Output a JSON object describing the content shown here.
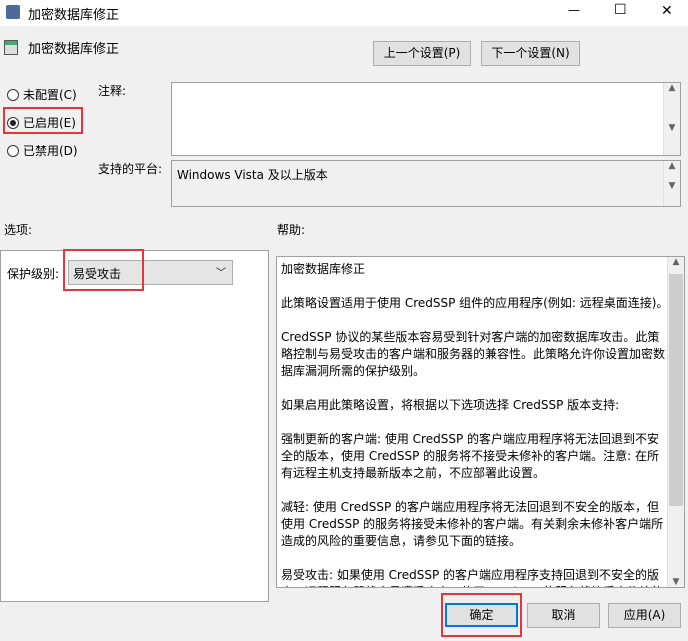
{
  "window": {
    "title": "加密数据库修正",
    "minimize": "—",
    "maximize": "☐",
    "close": "✕"
  },
  "header": {
    "title": "加密数据库修正",
    "prev_button": "上一个设置(P)",
    "next_button": "下一个设置(N)"
  },
  "state": {
    "options": [
      {
        "label": "未配置(C)",
        "selected": false
      },
      {
        "label": "已启用(E)",
        "selected": true
      },
      {
        "label": "已禁用(D)",
        "selected": false
      }
    ]
  },
  "comment": {
    "label": "注释:",
    "value": ""
  },
  "platform": {
    "label": "支持的平台:",
    "value": "Windows Vista 及以上版本"
  },
  "options_section": {
    "label": "选项:",
    "protection_label": "保护级别:",
    "protection_value": "易受攻击"
  },
  "help_section": {
    "label": "帮助:",
    "lines": [
      "加密数据库修正",
      "",
      "此策略设置适用于使用 CredSSP 组件的应用程序(例如: 远程桌面连接)。",
      "",
      "CredSSP 协议的某些版本容易受到针对客户端的加密数据库攻击。此策",
      "略控制与易受攻击的客户端和服务器的兼容性。此策略允许你设置加密数",
      "据库漏洞所需的保护级别。",
      "",
      "如果启用此策略设置，将根据以下选项选择 CredSSP 版本支持:",
      "",
      "强制更新的客户端: 使用 CredSSP 的客户端应用程序将无法回退到不安",
      "全的版本，使用 CredSSP 的服务将不接受未修补的客户端。注意: 在所",
      "有远程主机支持最新版本之前，不应部署此设置。",
      "",
      "减轻: 使用 CredSSP 的客户端应用程序将无法回退到不安全的版本，但",
      "使用 CredSSP 的服务将接受未修补的客户端。有关剩余未修补客户端所",
      "造成的风险的重要信息，请参见下面的链接。",
      "",
      "易受攻击: 如果使用 CredSSP 的客户端应用程序支持回退到不安全的版",
      "本，远程服务器将容易遭受攻击。使用 CredSSP 的服务将接受未修补的"
    ]
  },
  "footer": {
    "ok": "确定",
    "cancel": "取消",
    "apply": "应用(A)"
  }
}
